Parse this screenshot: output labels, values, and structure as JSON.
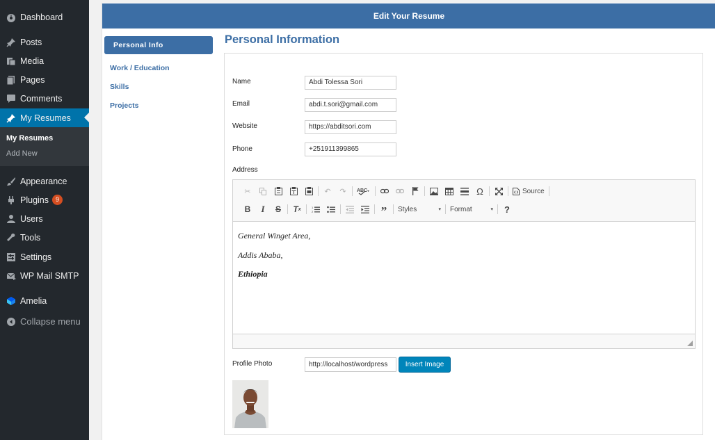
{
  "sidebar": {
    "items": [
      {
        "label": "Dashboard",
        "icon": "dashboard-icon"
      },
      {
        "label": "Posts",
        "icon": "pushpin-icon"
      },
      {
        "label": "Media",
        "icon": "media-icon"
      },
      {
        "label": "Pages",
        "icon": "pages-icon"
      },
      {
        "label": "Comments",
        "icon": "comment-icon"
      },
      {
        "label": "My Resumes",
        "icon": "pushpin-icon"
      },
      {
        "label": "Appearance",
        "icon": "paintbrush-icon"
      },
      {
        "label": "Plugins",
        "icon": "plugin-icon",
        "badge": "9"
      },
      {
        "label": "Users",
        "icon": "user-icon"
      },
      {
        "label": "Tools",
        "icon": "wrench-icon"
      },
      {
        "label": "Settings",
        "icon": "settings-icon"
      },
      {
        "label": "WP Mail SMTP",
        "icon": "mail-icon"
      },
      {
        "label": "Amelia",
        "icon": "amelia-icon"
      }
    ],
    "submenu": [
      "My Resumes",
      "Add New"
    ],
    "collapse_label": "Collapse menu"
  },
  "header": {
    "title": "Edit Your Resume"
  },
  "tabs": [
    "Personal Info",
    "Work / Education",
    "Skills",
    "Projects"
  ],
  "section_title": "Personal Information",
  "form": {
    "name_label": "Name",
    "name_value": "Abdi Tolessa Sori",
    "email_label": "Email",
    "email_value": "abdi.t.sori@gmail.com",
    "website_label": "Website",
    "website_value": "https://abditsori.com",
    "phone_label": "Phone",
    "phone_value": "+251911399865",
    "address_label": "Address",
    "photo_label": "Profile Photo",
    "photo_value": "http://localhost/wordpress",
    "insert_label": "Insert Image"
  },
  "editor": {
    "source_label": "Source",
    "styles_label": "Styles",
    "format_label": "Format",
    "lines": [
      "General Winget Area,",
      "Addis Ababa,",
      "Ethiopia"
    ]
  },
  "colors": {
    "accent": "#3c6ea5",
    "wp_active": "#0073aa",
    "wp_sidebar": "#23282d",
    "button": "#0085ba"
  }
}
